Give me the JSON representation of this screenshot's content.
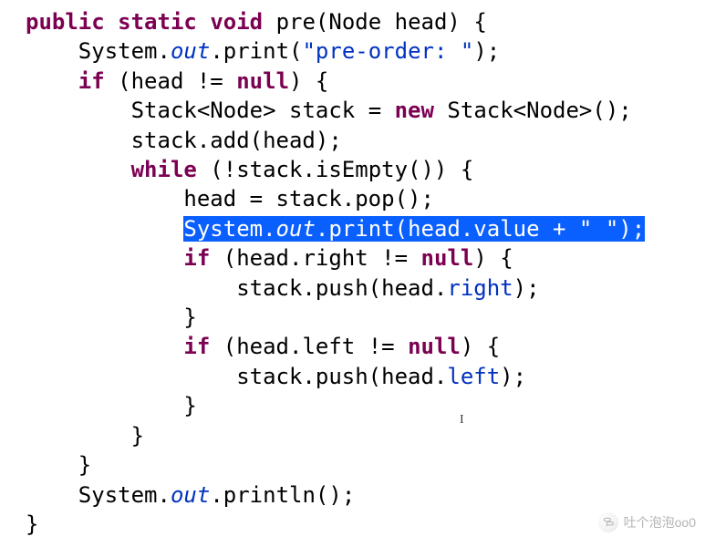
{
  "code": {
    "signature": {
      "kw_public": "public",
      "kw_static": "static",
      "kw_void": "void",
      "name": "pre",
      "param_type": "Node",
      "param_name": "head"
    },
    "print_preorder": {
      "class": "System",
      "dot1": ".",
      "out": "out",
      "dot2": ".",
      "method": "print",
      "str": "\"pre-order: \""
    },
    "if_head_not_null": {
      "kw_if": "if",
      "var": "head",
      "op": "!=",
      "kw_null": "null"
    },
    "stack_decl": {
      "type1": "Stack<Node>",
      "var": "stack",
      "eq": "=",
      "kw_new": "new",
      "type2": "Stack<Node>()"
    },
    "stack_add": "stack.add(head);",
    "while_not_empty": {
      "kw_while": "while",
      "cond": "(!stack.isEmpty())"
    },
    "head_pop": "head = stack.pop();",
    "print_value": {
      "class": "System",
      "dot1": ".",
      "out": "out",
      "dot2": ".",
      "method": "print",
      "arg1": "head.value",
      "plus": " + ",
      "str": "\" \""
    },
    "if_right": {
      "kw_if": "if",
      "expr": "(head.right",
      "op": "!=",
      "kw_null": "null",
      "close": ") {"
    },
    "push_right": {
      "text": "stack.push(head.",
      "right": "right",
      "close": ");"
    },
    "if_left": {
      "kw_if": "if",
      "expr": "(head.left",
      "op": "!=",
      "kw_null": "null",
      "close": ") {"
    },
    "push_left": {
      "text": "stack.push(head.",
      "left": "left",
      "close": ");"
    },
    "println": {
      "class": "System",
      "dot1": ".",
      "out": "out",
      "dot2": ".",
      "method": "println()"
    },
    "braces": {
      "open": "{",
      "close": "}"
    }
  },
  "cursor_glyph": "I",
  "watermark": {
    "text": "吐个泡泡oo0"
  }
}
